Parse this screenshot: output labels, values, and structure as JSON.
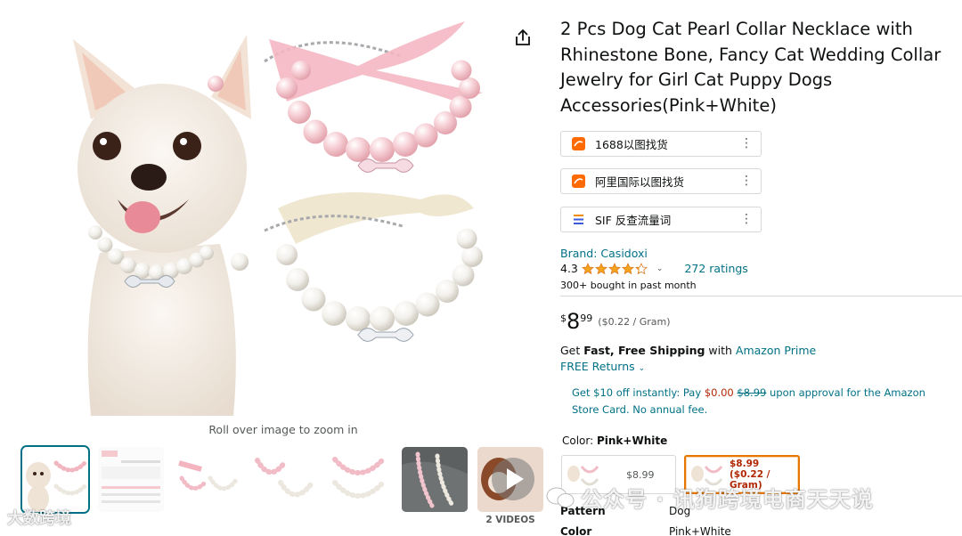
{
  "product": {
    "title": "2 Pcs Dog Cat Pearl Collar Necklace with Rhinestone Bone, Fancy Cat Wedding Collar Jewelry for Girl Cat Puppy Dogs Accessories(Pink+White)",
    "brand": "Brand: Casidoxi",
    "rating": "4.3",
    "stars": 4.3,
    "ratings_count": "272 ratings",
    "bought": "300+ bought in past month"
  },
  "gallery": {
    "zoom_hint": "Roll over image to zoom in",
    "videos_label": "2 VIDEOS",
    "thumbnails": [
      "main",
      "size-chart",
      "pearl-pair-a",
      "pearl-pair-b",
      "pearl-pair-c",
      "on-cloth",
      "video"
    ]
  },
  "plugins": [
    {
      "label": "1688以图找货",
      "icon": "1688-icon",
      "color": "#ff6a00"
    },
    {
      "label": "阿里国际以图找货",
      "icon": "alibaba-icon",
      "color": "#ff6a00"
    },
    {
      "label": "SIF 反查流量词",
      "icon": "sif-icon",
      "color": "#3b5bdb"
    }
  ],
  "price": {
    "currency": "$",
    "whole": "8",
    "fraction": "99",
    "unit": "($0.22 / Gram)"
  },
  "shipping": {
    "prefix": "Get ",
    "bold": "Fast, Free Shipping",
    "middle": " with ",
    "link": "Amazon Prime"
  },
  "returns": "FREE Returns",
  "promo": {
    "p1": "Get $10 off instantly: Pay ",
    "paid": "$0.00",
    "p2": " ",
    "old": "$8.99",
    "p3": " upon approval for the Amazon Store Card. No annual fee."
  },
  "color": {
    "label": "Color: ",
    "value": "Pink+White",
    "swatches": [
      {
        "price": "$8.99",
        "unit": ""
      },
      {
        "price": "$8.99",
        "unit": "($0.22 / Gram)"
      }
    ]
  },
  "specs": [
    {
      "key": "Pattern",
      "value": "Dog"
    },
    {
      "key": "Color",
      "value": "Pink+White"
    }
  ],
  "watermarks": {
    "left": "大数跨境",
    "right": "公众号 · 讯狗跨境电商天天说"
  },
  "colors": {
    "link": "#007185",
    "price_red": "#b12704",
    "selected_orange": "#e77600"
  }
}
